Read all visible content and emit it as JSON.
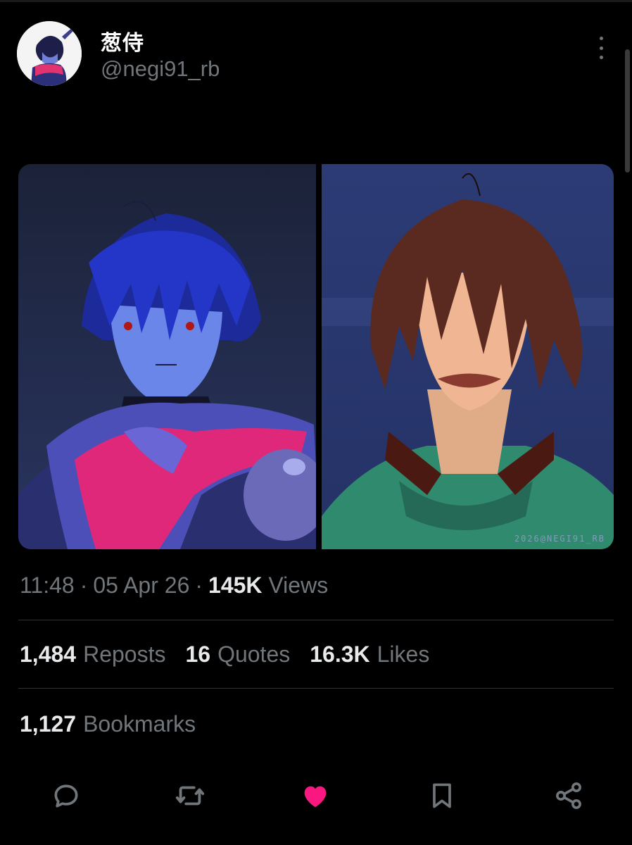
{
  "user": {
    "display_name": "葱侍",
    "handle": "@negi91_rb",
    "avatar_icon": "avatar-image"
  },
  "media": {
    "watermark": "2026@NEGI91_RB"
  },
  "meta": {
    "time": "11:48",
    "date": "05 Apr 26",
    "views_count": "145K",
    "views_label": "Views"
  },
  "stats": {
    "reposts_count": "1,484",
    "reposts_label": "Reposts",
    "quotes_count": "16",
    "quotes_label": "Quotes",
    "likes_count": "16.3K",
    "likes_label": "Likes",
    "bookmarks_count": "1,127",
    "bookmarks_label": "Bookmarks"
  },
  "actions": {
    "reply_icon": "reply-icon",
    "repost_icon": "repost-icon",
    "like_icon": "heart-icon",
    "bookmark_icon": "bookmark-icon",
    "share_icon": "share-icon",
    "like_color": "#f91880",
    "icon_color": "#71767b"
  },
  "colors": {
    "background": "#000000",
    "text_primary": "#e7e9ea",
    "text_secondary": "#71767b",
    "divider": "#2f3336"
  }
}
